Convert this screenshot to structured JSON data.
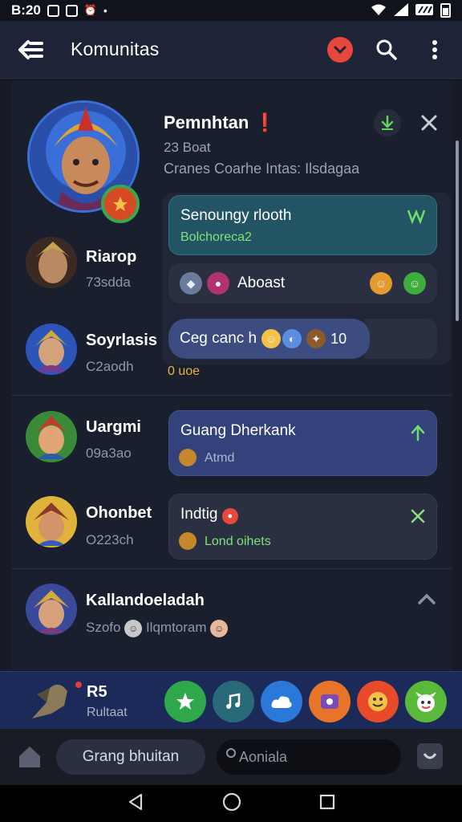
{
  "status_bar": {
    "time": "B:20"
  },
  "app_bar": {
    "title": "Komunitas"
  },
  "hero": {
    "name": "Pemnhtan",
    "name_mark": "❗",
    "subtitle": "23 Boat",
    "description": "Cranes Coarhe Intas: Ilsdagaa"
  },
  "messages": {
    "teal": {
      "title": "Senoungy rlooth",
      "subtitle": "Bolchoreca2"
    },
    "grey": {
      "title": "Aboast"
    },
    "blue": {
      "title": "Ceg canc h",
      "count": "10"
    },
    "note": "0 uoe"
  },
  "rows": [
    {
      "name": "Riarop",
      "sub": "73sdda"
    },
    {
      "name": "Soyrlasis",
      "sub": "C2aodh"
    },
    {
      "name": "Uargmi",
      "sub": "09a3ao",
      "msg_title": "Guang Dherkank",
      "msg_sub": "Atmd"
    },
    {
      "name": "Ohonbet",
      "sub": "O223ch",
      "msg_title": "Indtig",
      "msg_sub": "Lond oihets"
    },
    {
      "name": "Kallandoeladah",
      "sub": "Szofo",
      "sub2": "Ilqmtoram"
    }
  ],
  "strip": {
    "name": "R5",
    "sub": "Rultaat"
  },
  "input_bar": {
    "chip_label": "Grang bhuitan",
    "search_placeholder": "Aoniala"
  },
  "colors": {
    "accent": "#e8483a",
    "green": "#7ee27a",
    "teal_bubble": "#235464",
    "blue_bubble": "#3c4b80"
  }
}
